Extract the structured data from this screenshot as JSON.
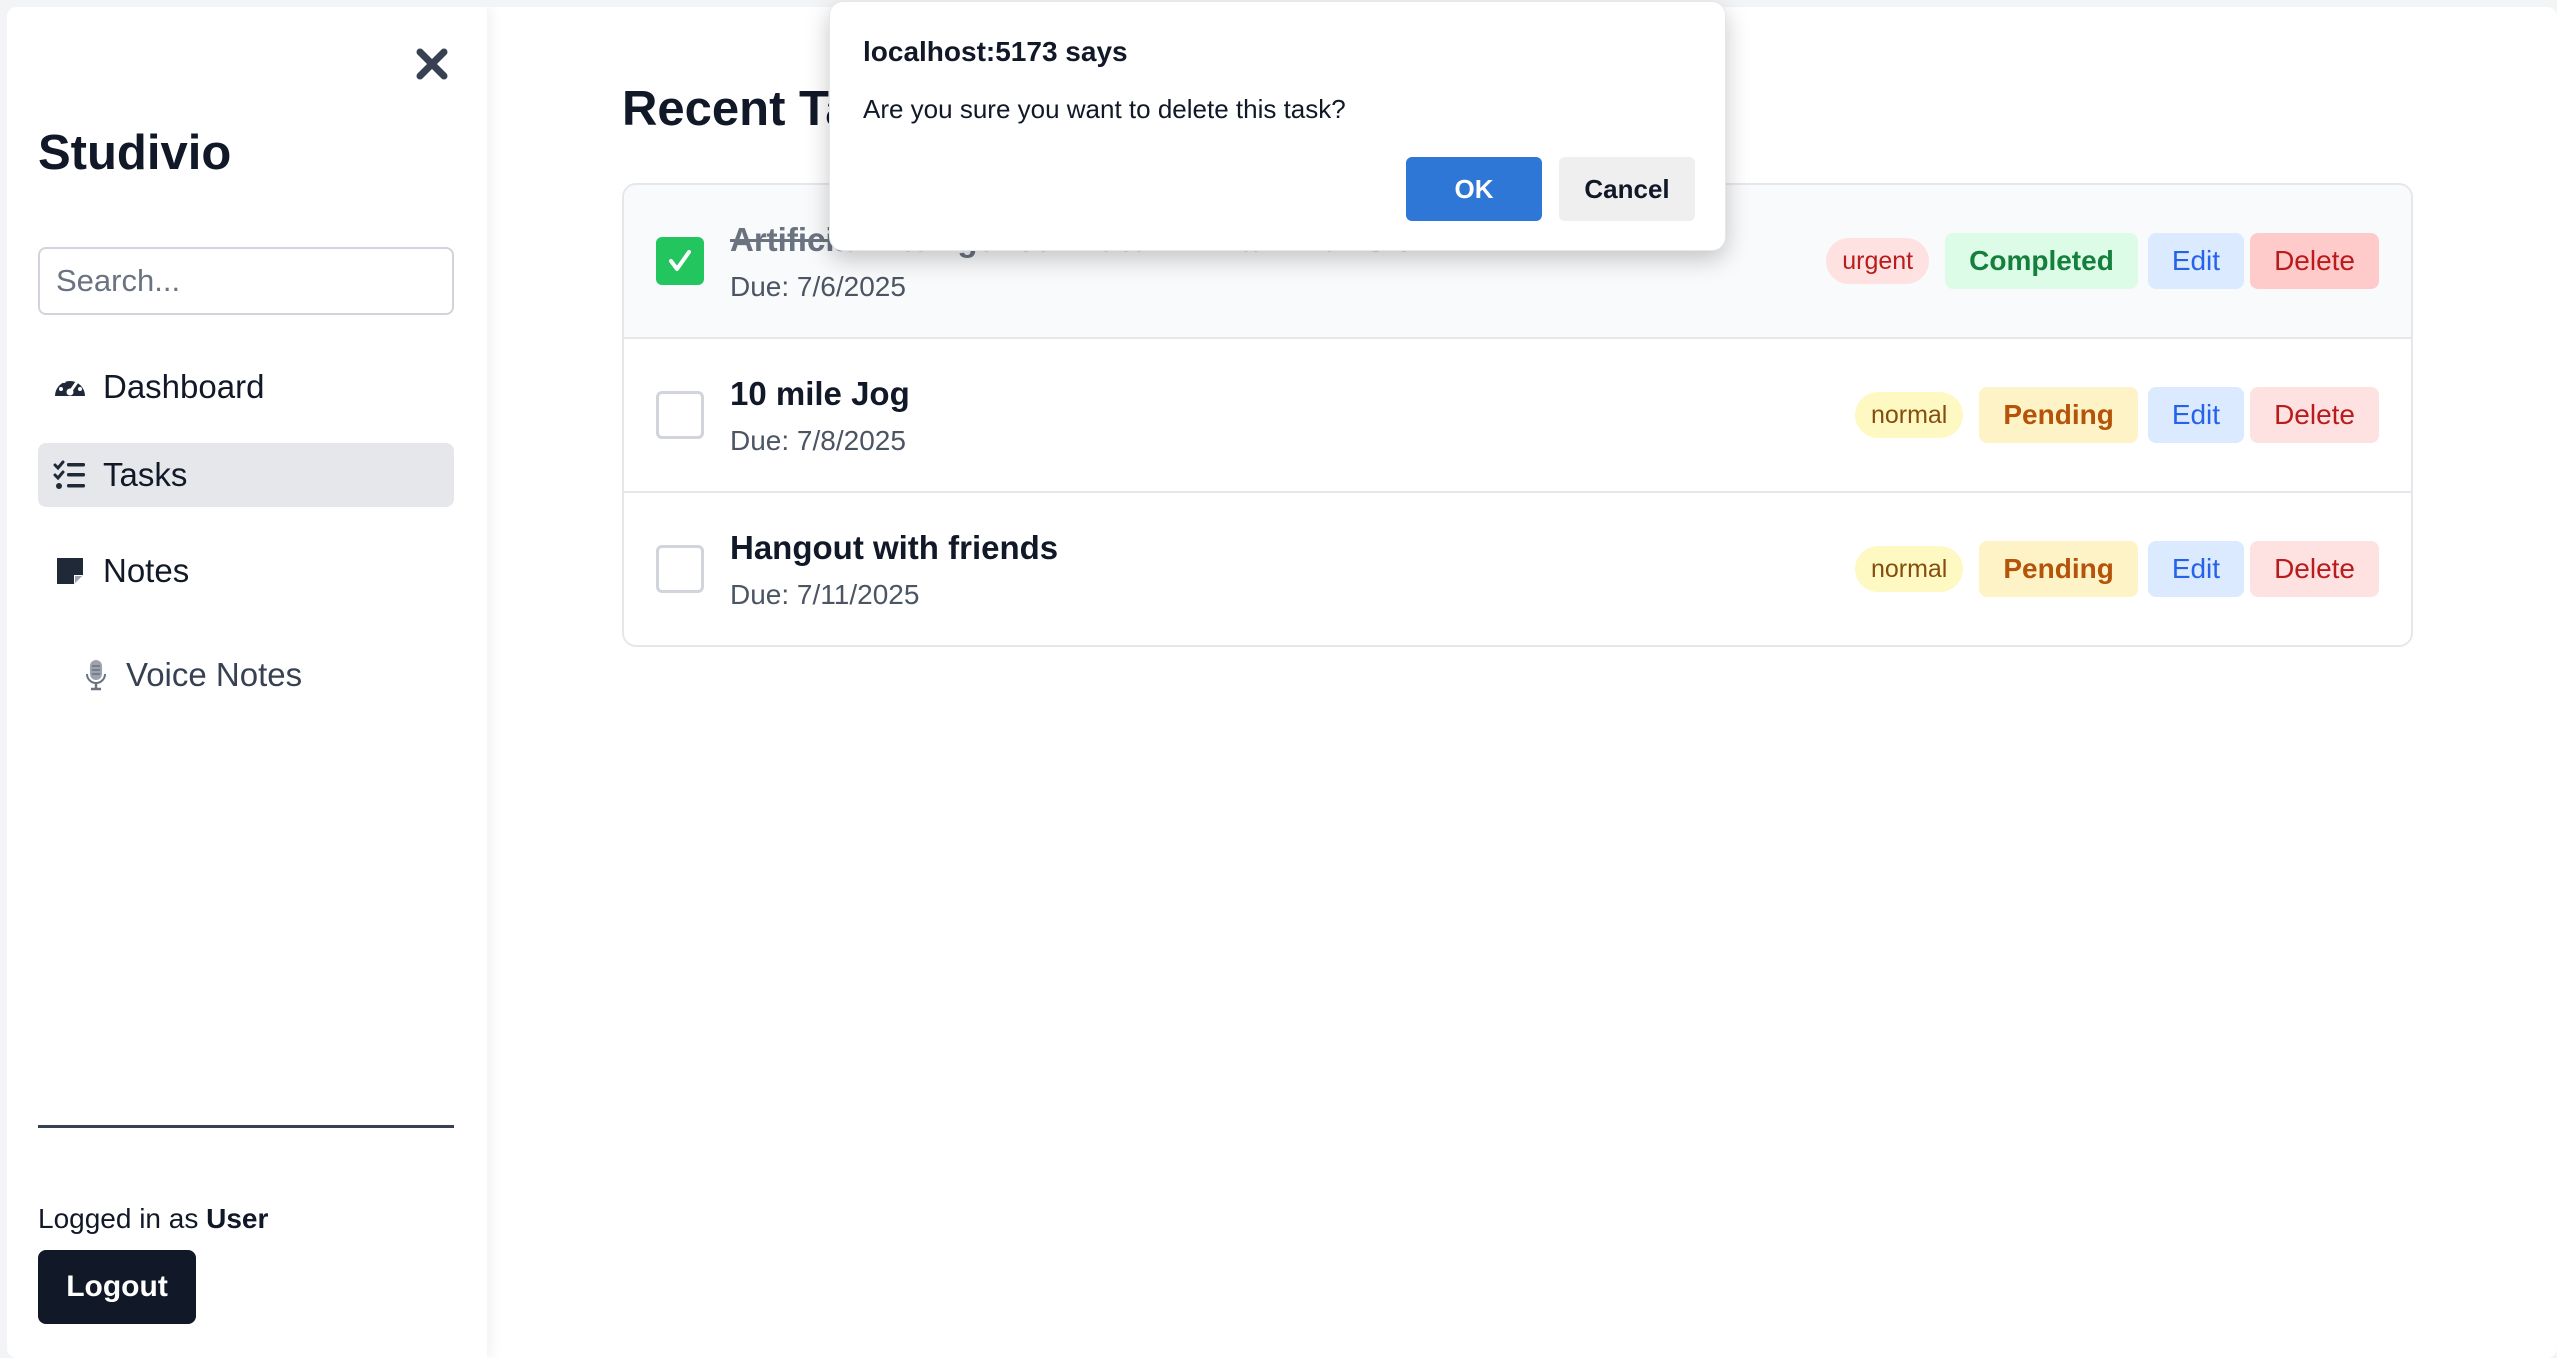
{
  "sidebar": {
    "brand": "Studivio",
    "search_placeholder": "Search...",
    "nav": [
      {
        "label": "Dashboard",
        "icon": "dashboard-gauge-icon",
        "active": false
      },
      {
        "label": "Tasks",
        "icon": "task-list-icon",
        "active": true
      },
      {
        "label": "Notes",
        "icon": "sticky-note-icon",
        "active": false
      },
      {
        "label": "Voice Notes",
        "icon": "microphone-icon",
        "active": false
      }
    ],
    "logged_prefix": "Logged in as",
    "user": "User",
    "logout_label": "Logout"
  },
  "main": {
    "title": "Recent Tasks",
    "tasks": [
      {
        "title": "Artificial Intelligence Midterm Exam Revision",
        "due": "Due: 7/6/2025",
        "priority": "urgent",
        "status": "Completed",
        "done": true,
        "edit": "Edit",
        "delete": "Delete"
      },
      {
        "title": "10 mile Jog",
        "due": "Due: 7/8/2025",
        "priority": "normal",
        "status": "Pending",
        "done": false,
        "edit": "Edit",
        "delete": "Delete"
      },
      {
        "title": "Hangout with friends",
        "due": "Due: 7/11/2025",
        "priority": "normal",
        "status": "Pending",
        "done": false,
        "edit": "Edit",
        "delete": "Delete"
      }
    ]
  },
  "dialog": {
    "title": "localhost:5173 says",
    "message": "Are you sure you want to delete this task?",
    "ok": "OK",
    "cancel": "Cancel"
  },
  "colors": {
    "dialog_ok": "#2f77d6",
    "completed": "#15803d",
    "pending": "#b45309",
    "checkbox_checked": "#22c55e"
  }
}
